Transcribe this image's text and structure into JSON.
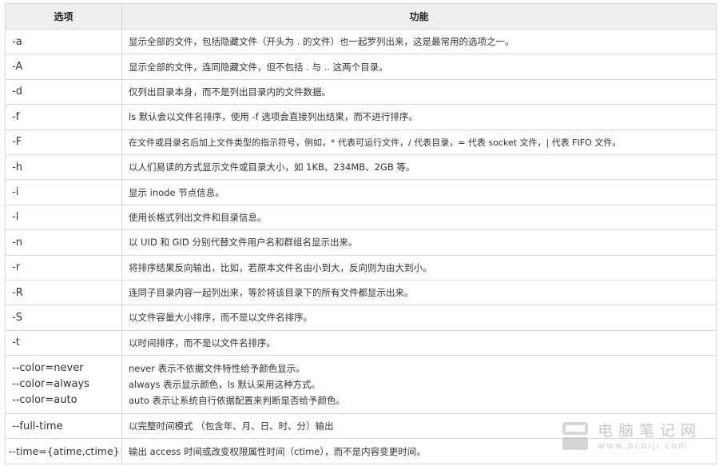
{
  "table": {
    "headers": {
      "option": "选项",
      "function": "功能"
    },
    "rows": [
      {
        "option": "-a",
        "desc": "显示全部的文件，包括隐藏文件（开头为 . 的文件）也一起罗列出来，这是最常用的选项之一。"
      },
      {
        "option": "-A",
        "desc": "显示全部的文件，连同隐藏文件，但不包括 . 与 .. 这两个目录。"
      },
      {
        "option": "-d",
        "desc": "仅列出目录本身，而不是列出目录内的文件数据。"
      },
      {
        "option": "-f",
        "desc": "ls 默认会以文件名排序，使用 -f 选项会直接列出结果，而不进行排序。"
      },
      {
        "option": "-F",
        "desc": "在文件或目录名后加上文件类型的指示符号，例如，* 代表可运行文件，/ 代表目录，= 代表 socket 文件，| 代表 FIFO 文件。"
      },
      {
        "option": "-h",
        "desc": "以人们易读的方式显示文件或目录大小，如 1KB、234MB、2GB 等。"
      },
      {
        "option": "-i",
        "desc": "显示 inode 节点信息。"
      },
      {
        "option": "-l",
        "desc": "使用长格式列出文件和目录信息。"
      },
      {
        "option": "-n",
        "desc": "以 UID 和 GID 分别代替文件用户名和群组名显示出来。"
      },
      {
        "option": "-r",
        "desc": "将排序结果反向输出，比如，若原本文件名由小到大，反向则为由大到小。"
      },
      {
        "option": "-R",
        "desc": "连同子目录内容一起列出来，等於将该目录下的所有文件都显示出来。"
      },
      {
        "option": "-S",
        "desc": "以文件容量大小排序，而不是以文件名排序。"
      },
      {
        "option": "-t",
        "desc": "以时间排序，而不是以文件名排序。"
      }
    ],
    "color_row": {
      "options": [
        "--color=never",
        "--color=always",
        "--color=auto"
      ],
      "descs": [
        "never 表示不依据文件特性给予颜色显示。",
        "always 表示显示颜色，ls 默认采用这种方式。",
        "auto 表示让系统自行依据配置来判断是否给予颜色。"
      ]
    },
    "tail_rows": [
      {
        "option": "--full-time",
        "desc": "以完整时间模式 （包含年、月、日、时、分）输出"
      },
      {
        "option": "--time={atime,ctime}",
        "desc": "输出 access 时间或改变权限属性时间（ctime），而不是内容变更时间。"
      }
    ]
  },
  "watermark": {
    "name": "电脑笔记网",
    "url": "www.pcbiji.com"
  }
}
